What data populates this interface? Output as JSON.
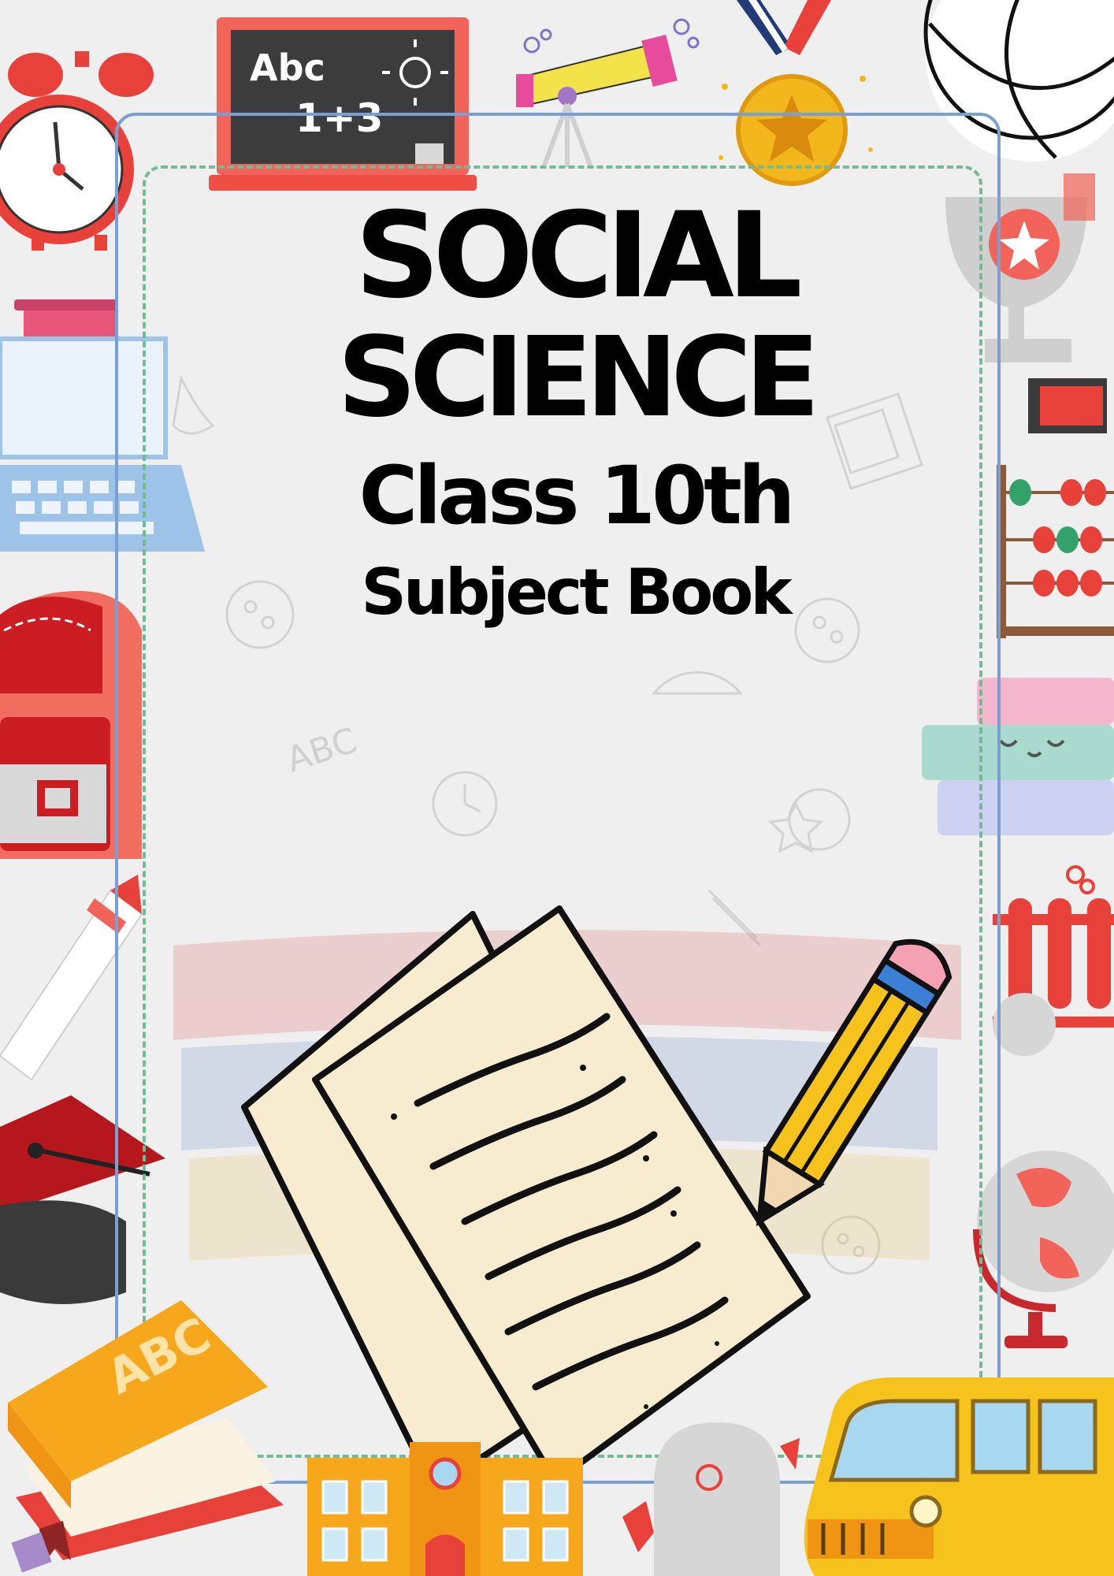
{
  "cover": {
    "title_line1": "SOCIAL",
    "title_line2": "SCIENCE",
    "class_line": "Class 10th",
    "subtitle": "Subject Book"
  },
  "chalkboard": {
    "line1": "Abc",
    "line2": "1+3"
  },
  "stack_book_cover": "ABC",
  "background_doodle": "ABC",
  "colors": {
    "background": "#efefef",
    "outer_frame": "#7a9fd3",
    "inner_frame_dashed": "#72bb94",
    "title_text": "#000000",
    "accent_red": "#e8413a",
    "accent_yellow": "#f6c31c"
  },
  "icons": [
    "alarm-clock-icon",
    "chalkboard-icon",
    "telescope-icon",
    "medal-icon",
    "globe-lines-icon",
    "book-icon",
    "laptop-icon",
    "backpack-icon",
    "pencil-icon",
    "graduation-cap-icon",
    "trophy-icon",
    "abacus-icon",
    "book-stack-icon",
    "test-tubes-icon",
    "desk-globe-icon",
    "paper-sheets-icon",
    "writing-pencil-icon",
    "abc-books-icon",
    "school-building-icon",
    "robot-icon",
    "school-bus-icon"
  ]
}
